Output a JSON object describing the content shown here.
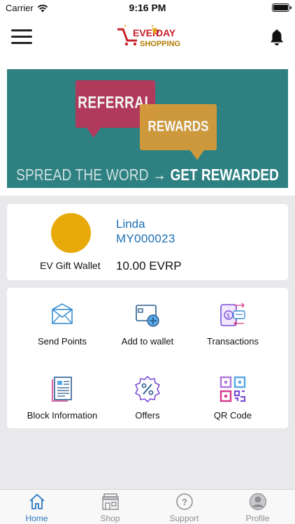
{
  "status_bar": {
    "carrier": "Carrier",
    "time": "9:16 PM"
  },
  "header": {
    "logo_text_top": "EVERYDAY",
    "logo_text_bottom": "SHOPPING"
  },
  "banner": {
    "bubble_1": "REFERRAL",
    "bubble_2": "REWARDS",
    "tagline_1": "SPREAD THE WORD",
    "tagline_2": "GET REWARDED"
  },
  "wallet": {
    "label": "EV Gift Wallet",
    "user_name": "Linda",
    "user_id": "MY000023",
    "balance": "10.00 EVRP",
    "coin_color": "#e8a90a"
  },
  "actions": [
    {
      "label": "Send Points",
      "icon": "envelope-icon"
    },
    {
      "label": "Add to wallet",
      "icon": "wallet-add-icon"
    },
    {
      "label": "Transactions",
      "icon": "transactions-icon"
    },
    {
      "label": "Block Information",
      "icon": "document-icon"
    },
    {
      "label": "Offers",
      "icon": "percent-badge-icon"
    },
    {
      "label": "QR Code",
      "icon": "qr-code-icon"
    }
  ],
  "tabbar": {
    "active": "Home",
    "items": [
      {
        "label": "Home",
        "icon": "home-icon"
      },
      {
        "label": "Shop",
        "icon": "shop-icon"
      },
      {
        "label": "Support",
        "icon": "help-icon"
      },
      {
        "label": "Profile",
        "icon": "profile-icon"
      }
    ]
  },
  "colors": {
    "link_blue": "#1c6fb3",
    "tab_active": "#2a78c2",
    "tab_inactive": "#8e8e93"
  }
}
